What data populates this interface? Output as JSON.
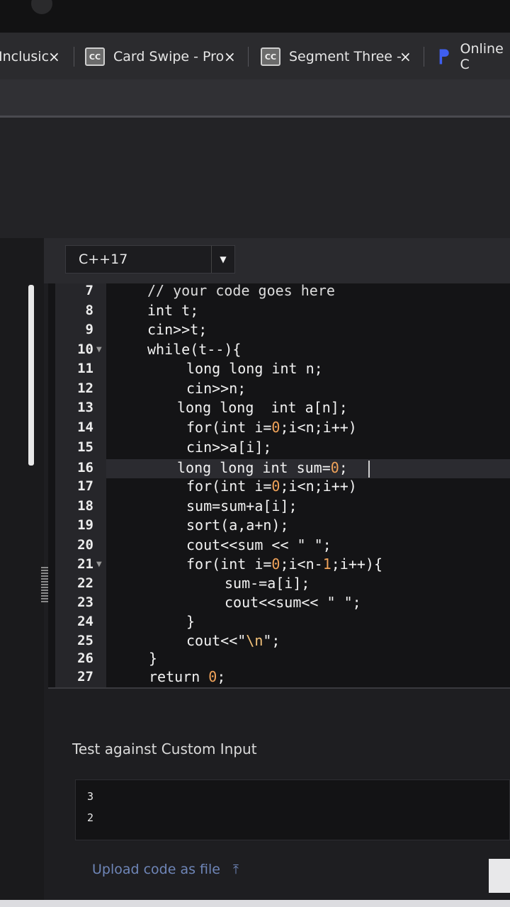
{
  "browser": {
    "tabs": [
      {
        "title": "Inclusic",
        "close": "×"
      },
      {
        "title": "Card Swipe - Pro",
        "close": "×",
        "icon": "CC"
      },
      {
        "title": "Segment Three -",
        "close": "×",
        "icon": "CC"
      },
      {
        "title": "Online C"
      }
    ]
  },
  "editor": {
    "language": "C++17",
    "lines": [
      {
        "n": "7"
      },
      {
        "n": "8"
      },
      {
        "n": "9"
      },
      {
        "n": "10"
      },
      {
        "n": "11"
      },
      {
        "n": "12"
      },
      {
        "n": "13"
      },
      {
        "n": "14"
      },
      {
        "n": "15"
      },
      {
        "n": "16"
      },
      {
        "n": "17"
      },
      {
        "n": "18"
      },
      {
        "n": "19"
      },
      {
        "n": "20"
      },
      {
        "n": "21"
      },
      {
        "n": "22"
      },
      {
        "n": "23"
      },
      {
        "n": "24"
      },
      {
        "n": "25"
      },
      {
        "n": "26"
      },
      {
        "n": "27"
      }
    ],
    "code": {
      "l7": "// your code goes here",
      "l8": "int t;",
      "l9": "cin>>t;",
      "l10": "while(t--){",
      "l11": "long long int n;",
      "l12": "cin>>n;",
      "l13": "long long  int a[n];",
      "l14a": "for(int i=",
      "l14n": "0",
      "l14b": ";i<n;i++)",
      "l15": "cin>>a[i];",
      "l16a": "long long int sum=",
      "l16n": "0",
      "l16b": ";",
      "l17a": "for(int i=",
      "l17n": "0",
      "l17b": ";i<n;i++)",
      "l18": "sum=sum+a[i];",
      "l19": "sort(a,a+n);",
      "l20": "cout<<sum << \" \";",
      "l21a": "for(int i=",
      "l21n": "0",
      "l21b": ";i<n-",
      "l21n2": "1",
      "l21c": ";i++){",
      "l22": "sum-=a[i];",
      "l23": "cout<<sum<< \" \";",
      "l24": "}",
      "l25a": "cout<<\"",
      "l25e": "\\n",
      "l25b": "\";",
      "l26": "}",
      "l27a": "return ",
      "l27n": "0",
      "l27b": ";"
    }
  },
  "custom_input": {
    "label": "Test against Custom Input",
    "lines": [
      "3",
      "2"
    ]
  },
  "upload": {
    "label": "Upload code as file",
    "icon": "upload-icon"
  }
}
